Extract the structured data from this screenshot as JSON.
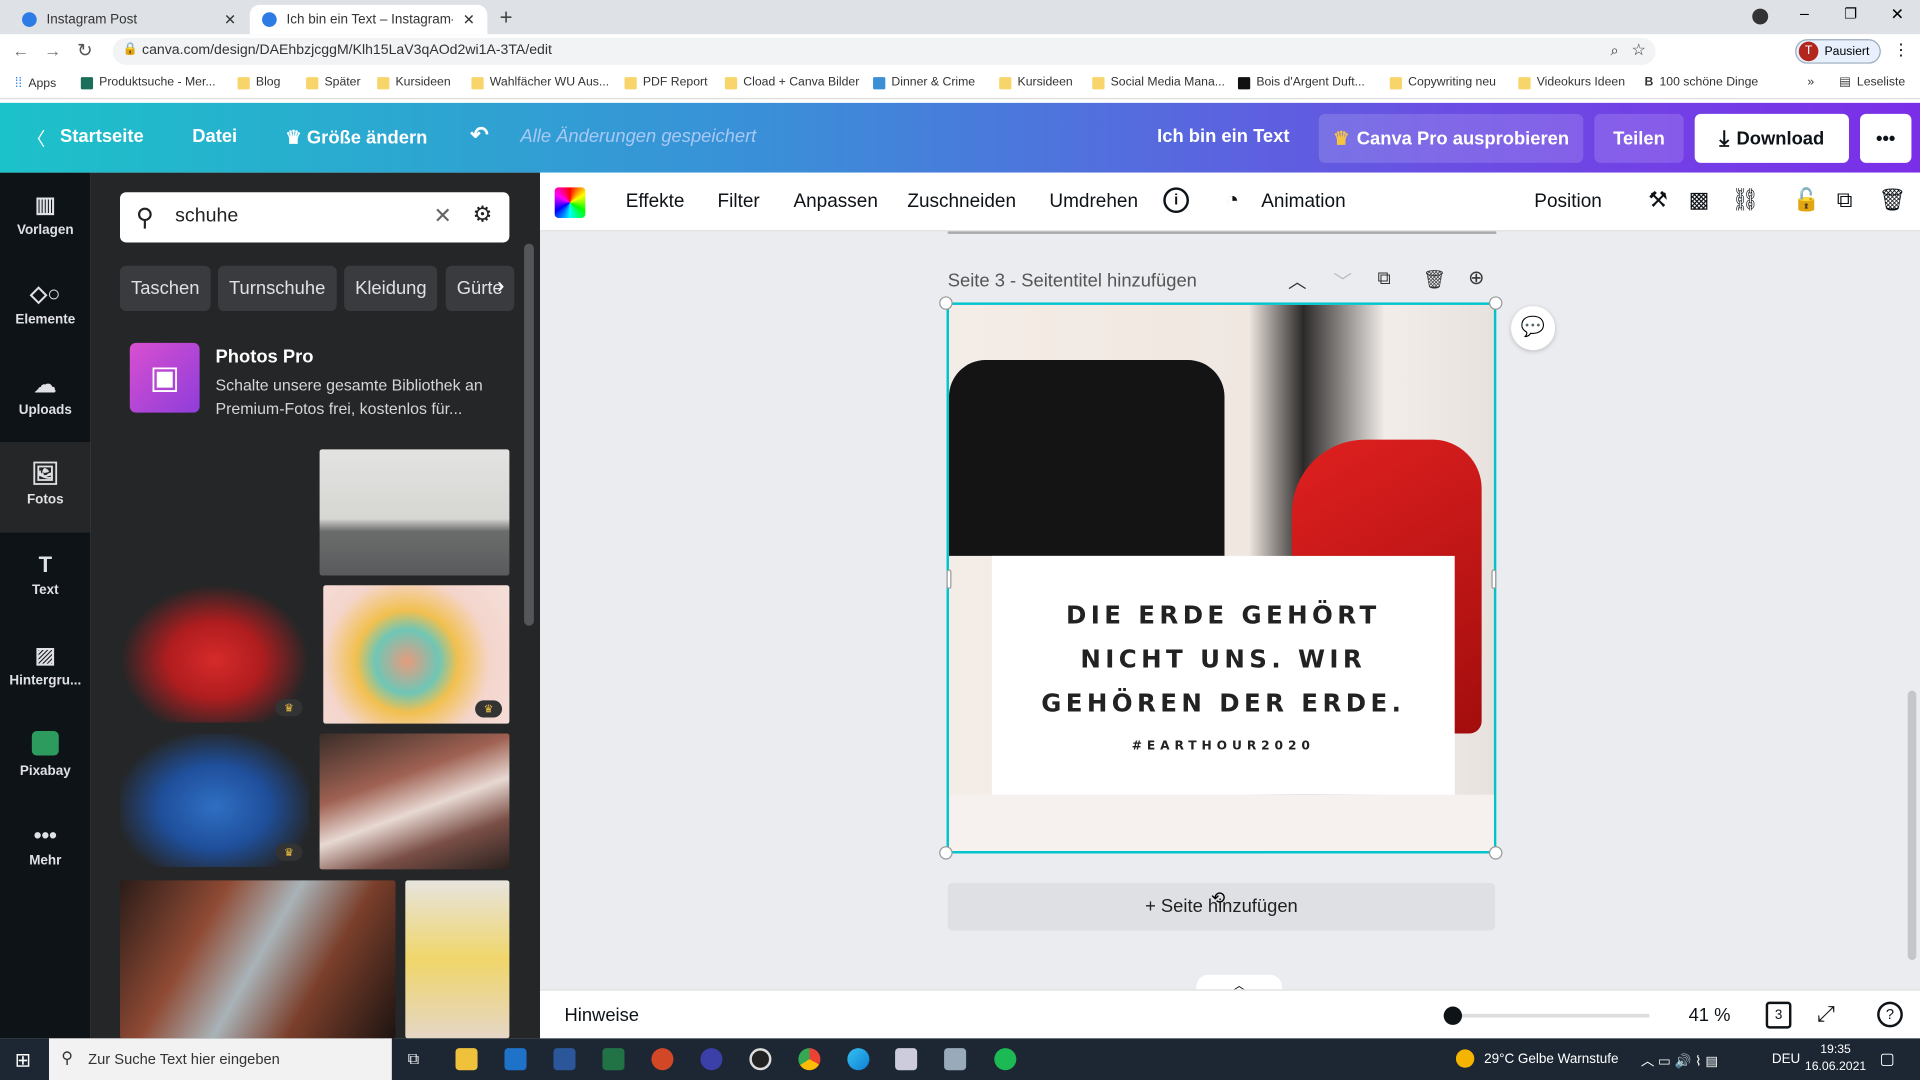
{
  "browser": {
    "tabs": [
      {
        "title": "Instagram Post",
        "active": false
      },
      {
        "title": "Ich bin ein Text – Instagram-Beit",
        "active": true
      }
    ],
    "url": "canva.com/design/DAEhbzjcggM/Klh15LaV3qAOd2wi1A-3TA/edit",
    "profile_label": "Pausiert",
    "profile_initial": "T",
    "bookmarks": [
      "Apps",
      "Produktsuche - Mer...",
      "Blog",
      "Später",
      "Kursideen",
      "Wahlfächer WU Aus...",
      "PDF Report",
      "Cload + Canva Bilder",
      "Dinner & Crime",
      "Kursideen",
      "Social Media Mana...",
      "Bois d'Argent Duft...",
      "Copywriting neu",
      "Videokurs Ideen",
      "100 schöne Dinge"
    ],
    "reading_list": "Leseliste"
  },
  "header": {
    "home": "Startseite",
    "file": "Datei",
    "resize": "Größe ändern",
    "saved_status": "Alle Änderungen gespeichert",
    "design_title": "Ich bin ein Text",
    "pro": "Canva Pro ausprobieren",
    "share": "Teilen",
    "download": "Download",
    "more": "•••"
  },
  "rail": [
    {
      "label": "Vorlagen",
      "icon": "template-icon"
    },
    {
      "label": "Elemente",
      "icon": "shapes-icon"
    },
    {
      "label": "Uploads",
      "icon": "cloud-upload-icon"
    },
    {
      "label": "Fotos",
      "icon": "image-icon",
      "active": true
    },
    {
      "label": "Text",
      "icon": "text-icon"
    },
    {
      "label": "Hintergru...",
      "icon": "pattern-icon"
    },
    {
      "label": "Pixabay",
      "icon": "pixabay-icon"
    },
    {
      "label": "Mehr",
      "icon": "more-icon"
    }
  ],
  "panel": {
    "search_value": "schuhe",
    "chips": [
      "Taschen",
      "Turnschuhe",
      "Kleidung",
      "Gürte"
    ],
    "promo_title": "Photos Pro",
    "promo_text": "Schalte unsere gesamte Bibliothek an Premium-Fotos frei, kostenlos für..."
  },
  "toolbar": {
    "items": [
      "Effekte",
      "Filter",
      "Anpassen",
      "Zuschneiden",
      "Umdrehen"
    ],
    "animation": "Animation",
    "position": "Position"
  },
  "page": {
    "label": "Seite 3 - Seitentitel hinzufügen",
    "quote_lines": [
      "DIE ERDE GEHÖRT",
      "NICHT UNS. WIR",
      "GEHÖREN DER ERDE."
    ],
    "hashtag": "#EARTHOUR2020",
    "add_page": "+ Seite hinzufügen"
  },
  "bottom": {
    "notes": "Hinweise",
    "zoom": "41 %",
    "zoom_level_percent": 41,
    "page_count": "3"
  },
  "taskbar": {
    "search_placeholder": "Zur Suche Text hier eingeben",
    "weather": "29°C  Gelbe Warnstufe",
    "lang": "DEU",
    "time": "19:35",
    "date": "16.06.2021"
  },
  "colors": {
    "accent": "#00c4cc",
    "brand_purple": "#7d2ae8"
  }
}
